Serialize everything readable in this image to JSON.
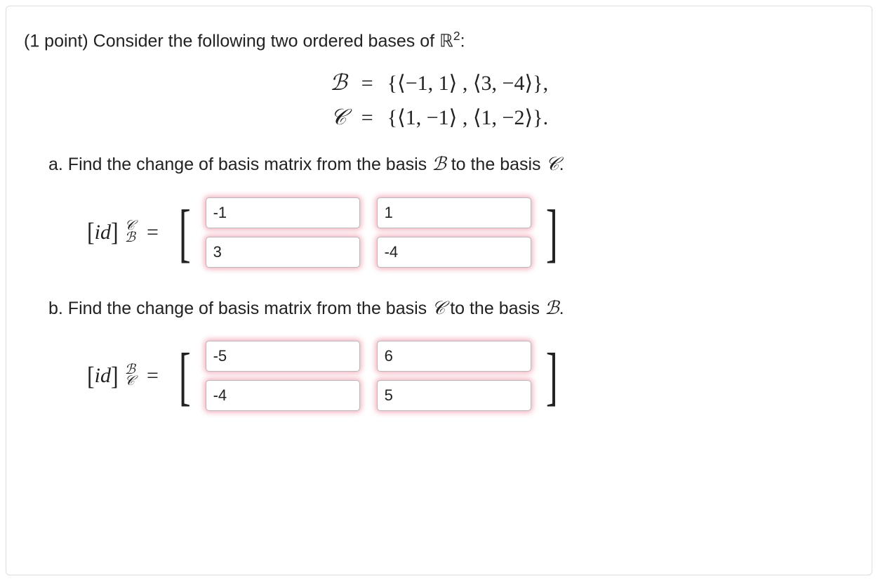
{
  "problem": {
    "points_prefix": "(1 point) ",
    "intro_text": "Consider the following two ordered bases of ",
    "space_symbol": "ℝ",
    "space_exponent": "2",
    "colon": ":"
  },
  "bases": {
    "B_symbol": "ℬ",
    "C_symbol": "𝒞",
    "eq": "=",
    "B_set": "{⟨−1, 1⟩ , ⟨3, −4⟩},",
    "C_set": "{⟨1, −1⟩ , ⟨1, −2⟩}."
  },
  "part_a": {
    "label": "a. ",
    "text": "Find the change of basis matrix from the basis ",
    "from": "ℬ",
    "mid": " to the basis ",
    "to": "𝒞",
    "end": "."
  },
  "part_b": {
    "label": "b. ",
    "text": "Find the change of basis matrix from the basis ",
    "from": "𝒞",
    "mid": " to the basis ",
    "to": "ℬ",
    "end": "."
  },
  "matrix_a": {
    "lhs_open": "[",
    "lhs_id": "id",
    "lhs_close": "]",
    "sup": "𝒞",
    "sub": "ℬ",
    "eq": "=",
    "cells": {
      "r1c1": "-1",
      "r1c2": "1",
      "r2c1": "3",
      "r2c2": "-4"
    }
  },
  "matrix_b": {
    "lhs_open": "[",
    "lhs_id": "id",
    "lhs_close": "]",
    "sup": "ℬ",
    "sub": "𝒞",
    "eq": "=",
    "cells": {
      "r1c1": "-5",
      "r1c2": "6",
      "r2c1": "-4",
      "r2c2": "5"
    }
  },
  "brackets": {
    "left": "[",
    "right": "]"
  }
}
